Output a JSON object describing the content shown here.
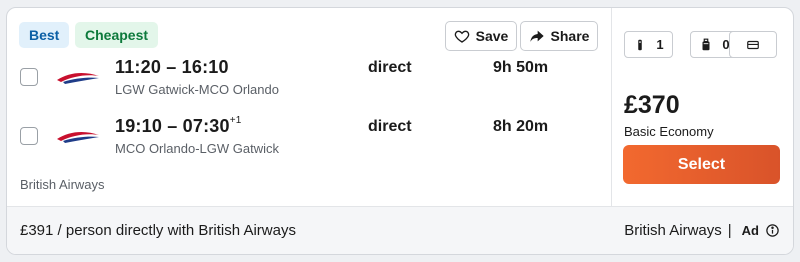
{
  "badges": {
    "best": "Best",
    "cheapest": "Cheapest"
  },
  "actions": {
    "save": "Save",
    "share": "Share"
  },
  "flights": [
    {
      "times": "11:20 – 16:10",
      "day_offset": "",
      "route": "LGW Gatwick-MCO Orlando",
      "stops": "direct",
      "duration": "9h 50m"
    },
    {
      "times": "19:10 – 07:30",
      "day_offset": "+1",
      "route": "MCO Orlando-LGW Gatwick",
      "stops": "direct",
      "duration": "8h 20m"
    }
  ],
  "airline": "British Airways",
  "baggage": {
    "personal_item": "1",
    "cabin_bag": "0",
    "card_icon": "credit-card-icon"
  },
  "price": "£370",
  "fare_class": "Basic Economy",
  "select_label": "Select",
  "footer": {
    "direct_offer": "£391 / person directly with British Airways",
    "provider": "British Airways",
    "separator": "|",
    "ad_label": "Ad"
  },
  "colors": {
    "select_start": "#f2692f",
    "select_end": "#d9532a",
    "best_bg": "#e1f0fb",
    "cheapest_bg": "#e3f6ea"
  }
}
